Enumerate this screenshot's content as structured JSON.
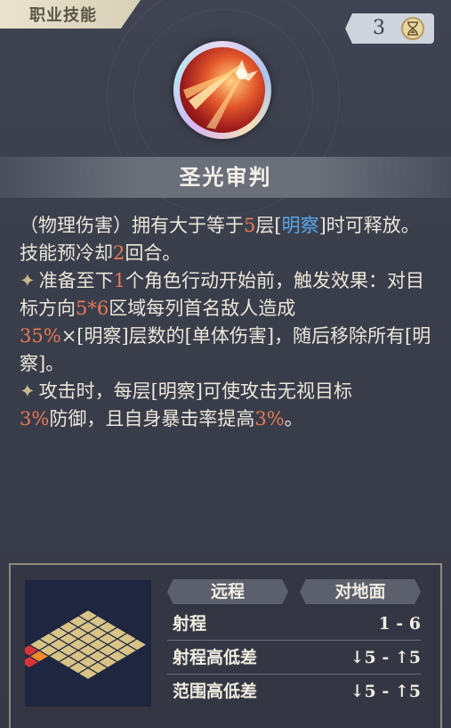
{
  "header": {
    "category_tag": "职业技能",
    "counter": "3"
  },
  "skill": {
    "icon": "holy-light-judgment-icon",
    "name": "圣光审判"
  },
  "description": {
    "p1_a": "（物理伤害）拥有大于等于",
    "p1_num": "5",
    "p1_b": "层[",
    "p1_kw": "明察",
    "p1_c": "]时可释放。技能预冷却",
    "p1_num2": "2",
    "p1_d": "回合。",
    "p2_a": "准备至下",
    "p2_num": "1",
    "p2_b": "个角色行动开始前，触发效果：对目标方向",
    "p2_num2": "5*6",
    "p2_c": "区域每列首名敌人造成",
    "p2_num3": "35%",
    "p2_d": "×[明察]层数的[单体伤害]，随后移除所有[明察]。",
    "p3_a": "攻击时，每层[明察]可使攻击无视目标",
    "p3_num": "3%",
    "p3_b": "防御，且自身暴击率提高",
    "p3_num2": "3%",
    "p3_c": "。"
  },
  "attributes": {
    "type_label": "远程",
    "target_label": "对地面",
    "range_label": "射程",
    "range_value": "1 - 6",
    "range_height_label": "射程高低差",
    "range_height_value": "↓5 - ↑5",
    "area_height_label": "范围高低差",
    "area_height_value": "↓5 - ↑5"
  },
  "colors": {
    "highlight_number": "#e57a55",
    "keyword": "#5aa6e6",
    "panel": "#3a3d48"
  }
}
